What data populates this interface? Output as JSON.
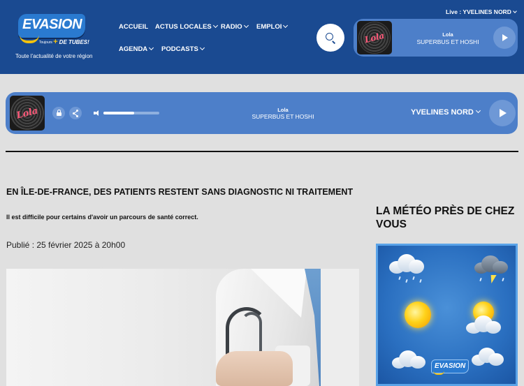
{
  "site": {
    "logo_text": "EVASION",
    "logo_small": "Toujours",
    "logo_plus": "+",
    "logo_tag": "DE TUBES!",
    "tagline": "Toute l'actualité de votre région"
  },
  "nav": {
    "items": [
      {
        "label": "ACCUEIL",
        "has_dropdown": false
      },
      {
        "label": "ACTUS LOCALES",
        "has_dropdown": true
      },
      {
        "label": "RADIO",
        "has_dropdown": true
      },
      {
        "label": "EMPLOI",
        "has_dropdown": true
      },
      {
        "label": "AGENDA",
        "has_dropdown": true
      },
      {
        "label": "PODCASTS",
        "has_dropdown": true
      }
    ]
  },
  "live": {
    "label": "Live : YVELINES NORD"
  },
  "mini_player": {
    "cover_text": "Lola",
    "title": "Lola",
    "artist": "SUPERBUS ET HOSHI"
  },
  "player": {
    "cover_text": "Lola",
    "title": "Lola",
    "artist": "SUPERBUS ET HOSHI",
    "station": "YVELINES NORD",
    "volume": 0.55
  },
  "article": {
    "title": "EN ÎLE-DE-FRANCE, DES PATIENTS RESTENT SANS DIAGNOSTIC NI TRAITEMENT",
    "subtitle": "Il est difficile pour certains d'avoir un parcours de santé correct.",
    "date": "Publié : 25 février 2025 à 20h00"
  },
  "sidebar": {
    "meteo_title": "LA MÉTÉO PRÈS DE CHEZ VOUS",
    "meteo_logo": "EVASION"
  },
  "colors": {
    "header_bg": "#1a4a91",
    "player_bg": "#4d7fc9",
    "page_bg": "#e0e0e0",
    "accent_yellow": "#f4c20d"
  }
}
